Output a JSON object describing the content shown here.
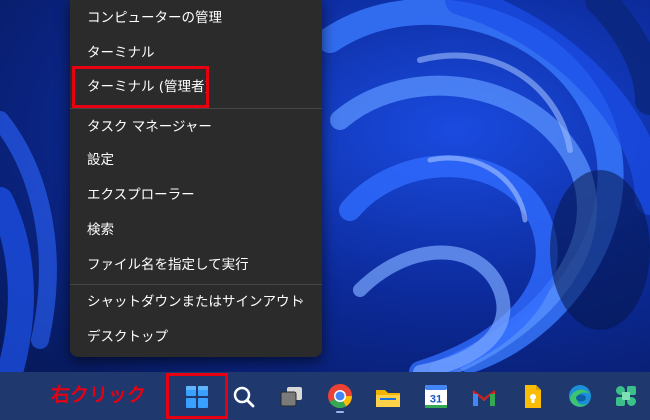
{
  "context_menu": {
    "items": [
      {
        "label": "コンピューターの管理"
      },
      {
        "label": "ターミナル"
      },
      {
        "label": "ターミナル (管理者)"
      },
      {
        "label": "タスク マネージャー"
      },
      {
        "label": "設定"
      },
      {
        "label": "エクスプローラー"
      },
      {
        "label": "検索"
      },
      {
        "label": "ファイル名を指定して実行"
      },
      {
        "label": "シャットダウンまたはサインアウト",
        "submenu_icon": "chevron-right-icon"
      },
      {
        "label": "デスクトップ"
      }
    ],
    "highlighted_item": "ターミナル (管理者)"
  },
  "annotation": {
    "label": "右クリック",
    "color": "#e60012"
  },
  "taskbar": {
    "icons": [
      "windows-start-icon",
      "search-icon",
      "task-view-icon",
      "chrome-icon",
      "file-explorer-icon",
      "calendar-icon",
      "gmail-icon",
      "keep-notes-icon",
      "edge-icon",
      "app-icon"
    ],
    "calendar_day": "31"
  },
  "colors": {
    "menu_bg": "#2b2b2b",
    "taskbar_bg": "#1f386e",
    "wallpaper_accent": "#1e5cff",
    "highlight": "#e60012"
  }
}
